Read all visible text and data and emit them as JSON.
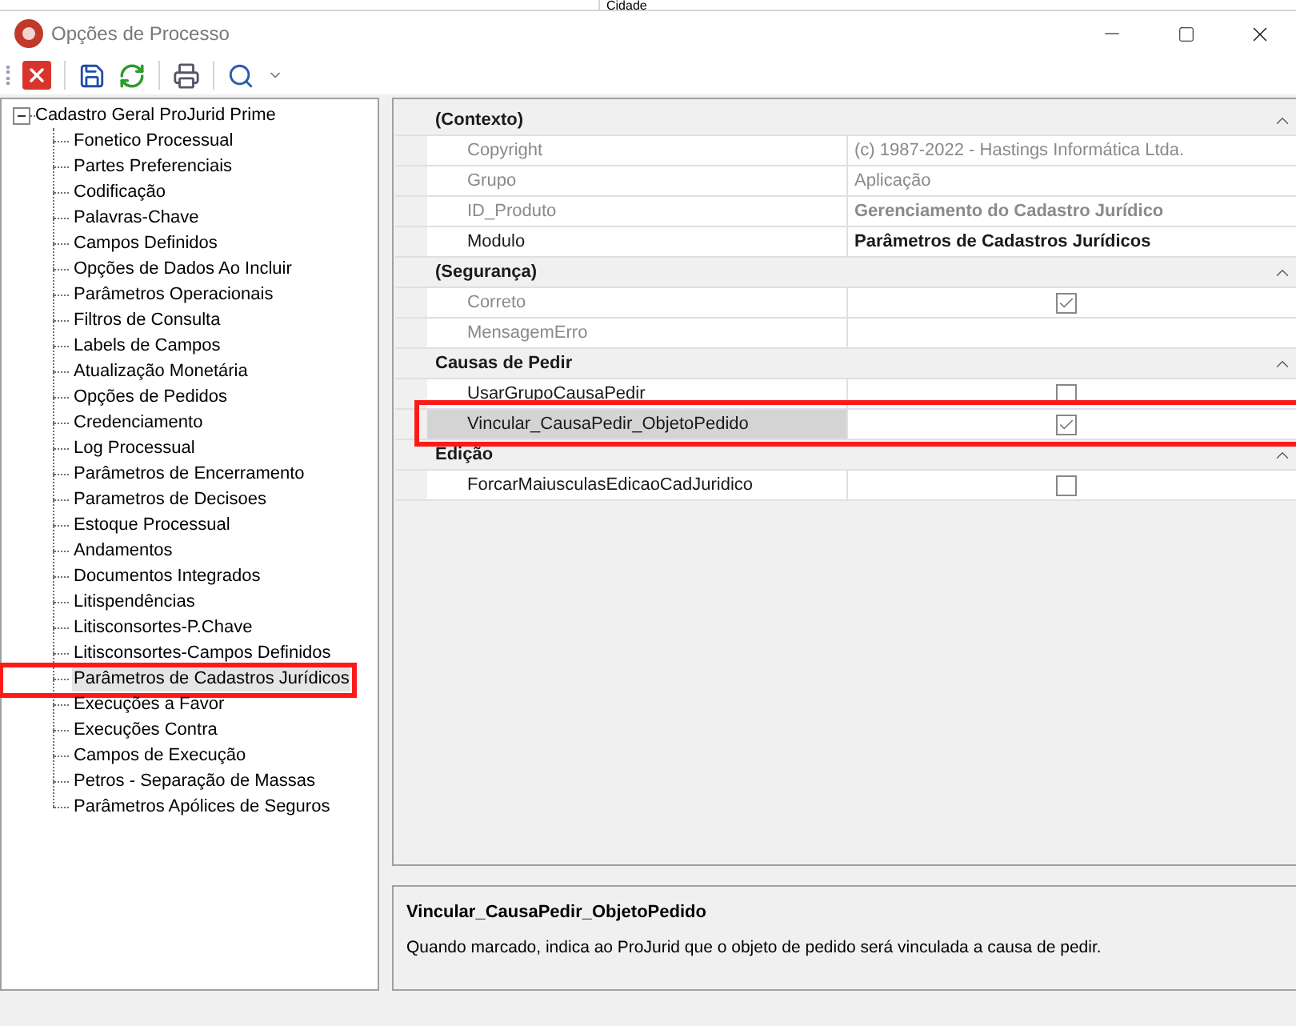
{
  "background_window": {
    "column_label": "Cidade"
  },
  "window": {
    "title": "Opções de Processo"
  },
  "tree": {
    "root": {
      "label": "Cadastro Geral ProJurid Prime",
      "expanded": true,
      "children": [
        {
          "label": "Fonetico Processual",
          "selected": false,
          "annotated": false
        },
        {
          "label": "Partes Preferenciais",
          "selected": false,
          "annotated": false
        },
        {
          "label": "Codificação",
          "selected": false,
          "annotated": false
        },
        {
          "label": "Palavras-Chave",
          "selected": false,
          "annotated": false
        },
        {
          "label": "Campos Definidos",
          "selected": false,
          "annotated": false
        },
        {
          "label": "Opções de Dados Ao Incluir",
          "selected": false,
          "annotated": false
        },
        {
          "label": "Parâmetros Operacionais",
          "selected": false,
          "annotated": false
        },
        {
          "label": "Filtros de Consulta",
          "selected": false,
          "annotated": false
        },
        {
          "label": "Labels de Campos",
          "selected": false,
          "annotated": false
        },
        {
          "label": "Atualização Monetária",
          "selected": false,
          "annotated": false
        },
        {
          "label": "Opções de Pedidos",
          "selected": false,
          "annotated": false
        },
        {
          "label": "Credenciamento",
          "selected": false,
          "annotated": false
        },
        {
          "label": "Log Processual",
          "selected": false,
          "annotated": false
        },
        {
          "label": "Parâmetros de Encerramento",
          "selected": false,
          "annotated": false
        },
        {
          "label": "Parametros de Decisoes",
          "selected": false,
          "annotated": false
        },
        {
          "label": "Estoque Processual",
          "selected": false,
          "annotated": false
        },
        {
          "label": "Andamentos",
          "selected": false,
          "annotated": false
        },
        {
          "label": "Documentos Integrados",
          "selected": false,
          "annotated": false
        },
        {
          "label": "Litispendências",
          "selected": false,
          "annotated": false
        },
        {
          "label": "Litisconsortes-P.Chave",
          "selected": false,
          "annotated": false
        },
        {
          "label": "Litisconsortes-Campos Definidos",
          "selected": false,
          "annotated": false
        },
        {
          "label": "Parâmetros de Cadastros Jurídicos",
          "selected": true,
          "annotated": true
        },
        {
          "label": "Execuções a Favor",
          "selected": false,
          "annotated": false
        },
        {
          "label": "Execuções Contra",
          "selected": false,
          "annotated": false
        },
        {
          "label": "Campos de Execução",
          "selected": false,
          "annotated": false
        },
        {
          "label": "Petros - Separação de Massas",
          "selected": false,
          "annotated": false
        },
        {
          "label": "Parâmetros Apólices de Seguros",
          "selected": false,
          "annotated": false
        }
      ]
    }
  },
  "properties": [
    {
      "category": "(Contexto)",
      "expanded": true,
      "rows": [
        {
          "name": "Copyright",
          "kind": "text",
          "value": "(c) 1987-2022 - Hastings Informática Ltda.",
          "readonly": true,
          "bold": false,
          "selected": false,
          "annotated": false
        },
        {
          "name": "Grupo",
          "kind": "text",
          "value": "Aplicação",
          "readonly": true,
          "bold": false,
          "selected": false,
          "annotated": false
        },
        {
          "name": "ID_Produto",
          "kind": "text",
          "value": "Gerenciamento do Cadastro Jurídico",
          "readonly": true,
          "bold": true,
          "selected": false,
          "annotated": false
        },
        {
          "name": "Modulo",
          "kind": "text",
          "value": "Parâmetros de Cadastros Jurídicos",
          "readonly": false,
          "bold": true,
          "selected": false,
          "annotated": false
        }
      ]
    },
    {
      "category": "(Segurança)",
      "expanded": true,
      "rows": [
        {
          "name": "Correto",
          "kind": "checkbox",
          "checked": true,
          "readonly": true,
          "selected": false,
          "annotated": false
        },
        {
          "name": "MensagemErro",
          "kind": "text",
          "readonly": true,
          "selected": false,
          "annotated": false
        }
      ]
    },
    {
      "category": "Causas de Pedir",
      "expanded": true,
      "rows": [
        {
          "name": "UsarGrupoCausaPedir",
          "kind": "checkbox",
          "checked": false,
          "readonly": false,
          "selected": false,
          "annotated": false
        },
        {
          "name": "Vincular_CausaPedir_ObjetoPedido",
          "kind": "checkbox",
          "checked": true,
          "readonly": false,
          "selected": true,
          "annotated": true
        }
      ]
    },
    {
      "category": "Edição",
      "expanded": true,
      "rows": [
        {
          "name": "ForcarMaiusculasEdicaoCadJuridico",
          "kind": "checkbox",
          "checked": false,
          "readonly": false,
          "selected": false,
          "annotated": false
        }
      ]
    }
  ],
  "description": {
    "title": "Vincular_CausaPedir_ObjetoPedido",
    "text": "Quando marcado, indica ao ProJurid que o objeto de pedido será vinculada a causa de pedir."
  }
}
